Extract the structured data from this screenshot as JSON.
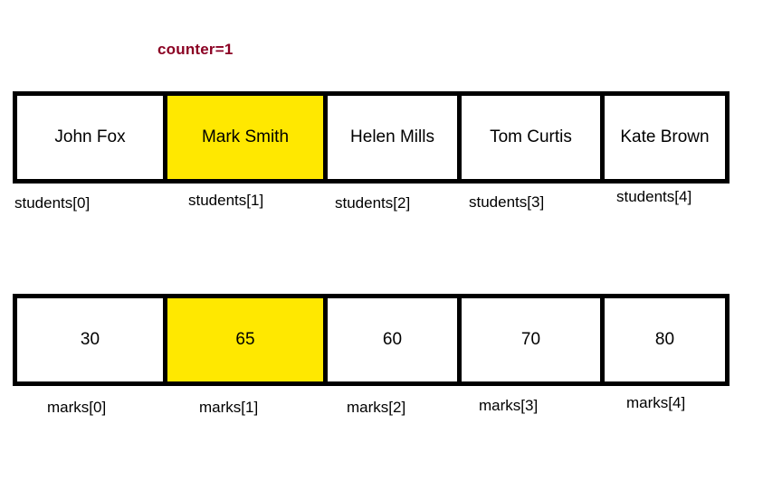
{
  "annotation": {
    "counter_text": "counter=1",
    "counter_color": "#8B0023"
  },
  "colors": {
    "highlight": "#FFE800",
    "border": "#000000",
    "cell_background": "#FFFFFF",
    "text": "#000000"
  },
  "arrays": [
    {
      "name": "students",
      "cells": [
        {
          "value": "John Fox",
          "label": "students[0]",
          "highlighted": false
        },
        {
          "value": "Mark Smith",
          "label": "students[1]",
          "highlighted": true
        },
        {
          "value": "Helen Mills",
          "label": "students[2]",
          "highlighted": false
        },
        {
          "value": "Tom Curtis",
          "label": "students[3]",
          "highlighted": false
        },
        {
          "value": "Kate Brown",
          "label": "students[4]",
          "highlighted": false
        }
      ]
    },
    {
      "name": "marks",
      "cells": [
        {
          "value": "30",
          "label": "marks[0]",
          "highlighted": false
        },
        {
          "value": "65",
          "label": "marks[1]",
          "highlighted": true
        },
        {
          "value": "60",
          "label": "marks[2]",
          "highlighted": false
        },
        {
          "value": "70",
          "label": "marks[3]",
          "highlighted": false
        },
        {
          "value": "80",
          "label": "marks[4]",
          "highlighted": false
        }
      ]
    }
  ]
}
